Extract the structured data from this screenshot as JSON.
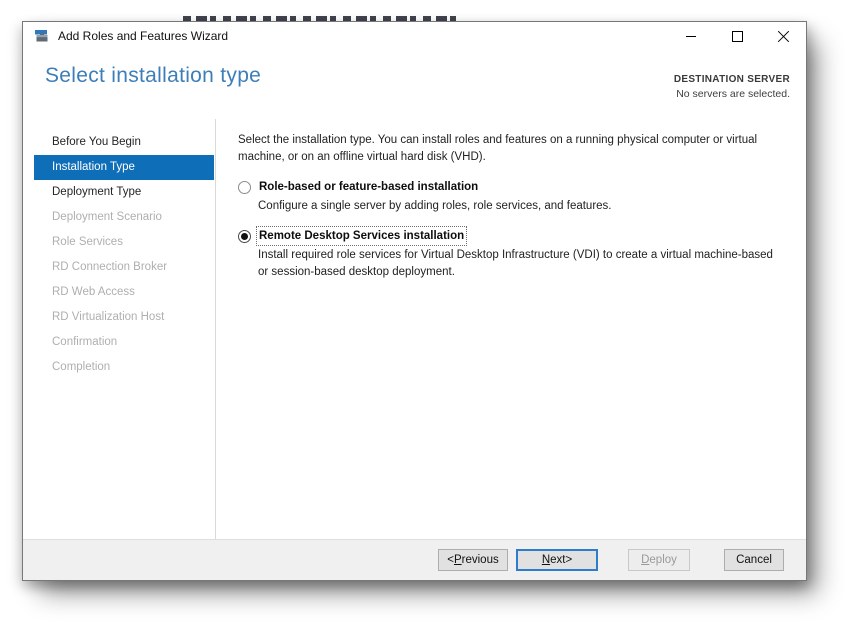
{
  "window": {
    "title": "Add Roles and Features Wizard",
    "app_icon": "server-manager-toolbox",
    "controls": {
      "minimize": "minimize",
      "maximize": "maximize",
      "close": "close"
    }
  },
  "header": {
    "title": "Select installation type",
    "destination_label": "DESTINATION SERVER",
    "destination_value": "No servers are selected."
  },
  "colors": {
    "heading_blue": "#3d7eba",
    "nav_selected_blue": "#0e6eb8",
    "default_button_border": "#2d7dc8"
  },
  "sidebar": {
    "items": [
      {
        "label": "Before You Begin",
        "state": "enabled"
      },
      {
        "label": "Installation Type",
        "state": "selected"
      },
      {
        "label": "Deployment Type",
        "state": "enabled"
      },
      {
        "label": "Deployment Scenario",
        "state": "disabled"
      },
      {
        "label": "Role Services",
        "state": "disabled"
      },
      {
        "label": "RD Connection Broker",
        "state": "disabled"
      },
      {
        "label": "RD Web Access",
        "state": "disabled"
      },
      {
        "label": "RD Virtualization Host",
        "state": "disabled"
      },
      {
        "label": "Confirmation",
        "state": "disabled"
      },
      {
        "label": "Completion",
        "state": "disabled"
      }
    ]
  },
  "content": {
    "intro": "Select the installation type. You can install roles and features on a running physical computer or virtual machine, or on an offline virtual hard disk (VHD).",
    "options": [
      {
        "label": "Role-based or feature-based installation",
        "description": "Configure a single server by adding roles, role services, and features.",
        "selected": false
      },
      {
        "label": "Remote Desktop Services installation",
        "description": "Install required role services for Virtual Desktop Infrastructure (VDI) to create a virtual machine-based or session-based desktop deployment.",
        "selected": true,
        "focused": true
      }
    ]
  },
  "footer": {
    "buttons": {
      "previous": {
        "pre": "< ",
        "mnemonic": "P",
        "rest": "revious",
        "enabled": true
      },
      "next": {
        "mnemonic": "N",
        "rest": "ext",
        "post": " >",
        "enabled": true,
        "default": true
      },
      "deploy": {
        "mnemonic": "D",
        "rest": "eploy",
        "enabled": false
      },
      "cancel": {
        "label": "Cancel",
        "enabled": true
      }
    }
  }
}
